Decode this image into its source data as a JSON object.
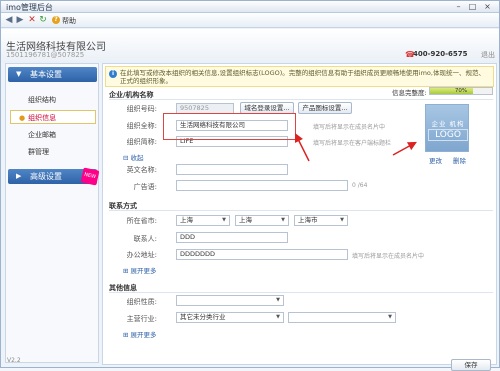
{
  "window": {
    "title": "imo管理后台",
    "minimize": "–",
    "maximize": "□",
    "close": "×"
  },
  "toolbar": {
    "help_label": "帮助",
    "help_icon": "?"
  },
  "header": {
    "company": "生活网络科技有限公司",
    "account": "1501196781@507825",
    "phone": "400-920-6575",
    "logout": "退出"
  },
  "sidebar": {
    "basic_title": "基本设置",
    "items": [
      {
        "label": "组织结构"
      },
      {
        "label": "组织信息"
      },
      {
        "label": "企业邮箱"
      },
      {
        "label": "群管理"
      }
    ],
    "advanced_title": "高级设置",
    "new_badge": "NEW"
  },
  "notice": {
    "icon": "i",
    "text": "在此填写或修改本组织的相关信息,设置组织标志(LOGO)。完整的组织信息有助于组织成员更顺畅地使用imo,体现统一、规范、正式的组织形象。"
  },
  "progress": {
    "label": "信息完整度:",
    "percent": 70,
    "percent_text": "70%"
  },
  "org": {
    "section_title": "企业/机构名称",
    "id_label": "组织号码:",
    "id_value": "9507825",
    "domain_btn": "域名登录设置...",
    "logo_btn": "产品图标设置...",
    "fullname_label": "组织全称:",
    "fullname_value": "生活网络科技有限公司",
    "fullname_hint": "填写后将显示在成员名片中",
    "short_label": "组织简称:",
    "short_value": "LIFE",
    "short_hint": "填写后将显示在客户端标题栏",
    "collapse": "收起",
    "english_label": "英文名称:",
    "ad_label": "广告语:",
    "ad_counter": "0 /64",
    "logo_text1": "企业 机构",
    "logo_text2": "LOGO",
    "logo_change": "更改",
    "logo_delete": "删除"
  },
  "contact": {
    "section_title": "联系方式",
    "province_label": "所在省市:",
    "province": "上海",
    "city": "上海",
    "district": "上海市",
    "person_label": "联系人:",
    "person_value": "DDD",
    "address_label": "办公地址:",
    "address_value": "DDDDDDD",
    "address_hint": "填写后将显示在成员名片中",
    "more": "展开更多"
  },
  "other": {
    "section_title": "其他信息",
    "nature_label": "组织性质:",
    "industry_label": "主营行业:",
    "industry_value": "其它未分类行业",
    "more": "展开更多"
  },
  "footer": {
    "save": "保存",
    "version": "V2.2"
  }
}
